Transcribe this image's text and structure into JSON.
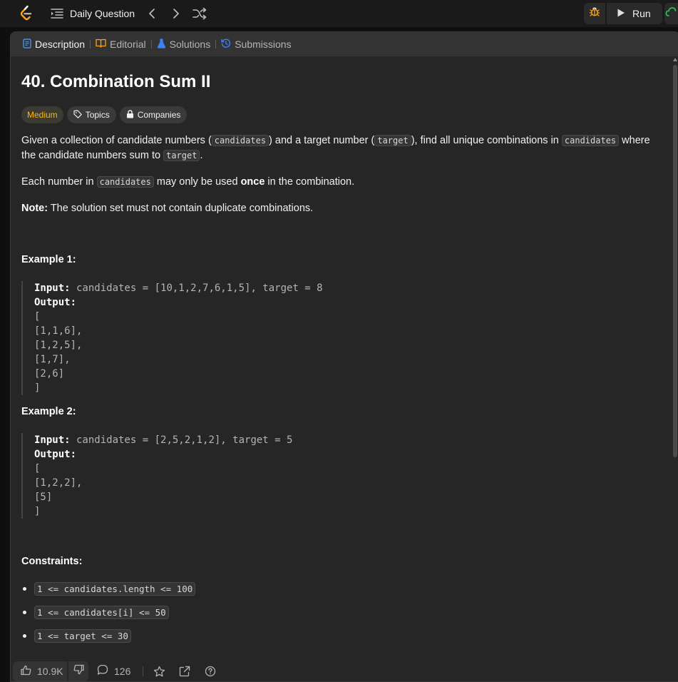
{
  "header": {
    "daily_question_label": "Daily Question",
    "run_label": "Run"
  },
  "tabs": [
    {
      "label": "Description",
      "active": true,
      "color": "#4a90e2"
    },
    {
      "label": "Editorial",
      "color": "#ffa116"
    },
    {
      "label": "Solutions",
      "color": "#3b82f6"
    },
    {
      "label": "Submissions",
      "color": "#3b82f6"
    }
  ],
  "problem": {
    "title": "40. Combination Sum II",
    "difficulty": "Medium",
    "topics_label": "Topics",
    "companies_label": "Companies",
    "desc1_a": "Given a collection of candidate numbers (",
    "desc1_code1": "candidates",
    "desc1_b": ") and a target number (",
    "desc1_code2": "target",
    "desc1_c": "), find all unique combinations in ",
    "desc1_code3": "candidates",
    "desc1_d": " where the candidate numbers sum to ",
    "desc1_code4": "target",
    "desc1_e": ".",
    "desc2_a": "Each number in ",
    "desc2_code": "candidates",
    "desc2_b": " may only be used ",
    "desc2_bold": "once",
    "desc2_c": " in the combination.",
    "note_label": "Note:",
    "note_text": " The solution set must not contain duplicate combinations."
  },
  "examples": [
    {
      "title": "Example 1:",
      "input_label": "Input:",
      "input": " candidates = [10,1,2,7,6,1,5], target = 8",
      "output_label": "Output:",
      "output_lines": [
        "[",
        "[1,1,6],",
        "[1,2,5],",
        "[1,7],",
        "[2,6]",
        "]"
      ]
    },
    {
      "title": "Example 2:",
      "input_label": "Input:",
      "input": " candidates = [2,5,2,1,2], target = 5",
      "output_label": "Output:",
      "output_lines": [
        "[",
        "[1,2,2],",
        "[5]",
        "]"
      ]
    }
  ],
  "constraints": {
    "title": "Constraints:",
    "items": [
      "1 <= candidates.length <= 100",
      "1 <= candidates[i] <= 50",
      "1 <= target <= 30"
    ]
  },
  "footer": {
    "likes": "10.9K",
    "comments": "126"
  },
  "colors": {
    "background": "#0f0f0f",
    "panel": "#262626",
    "medium": "#ffb800",
    "brand": "#ffa116"
  }
}
